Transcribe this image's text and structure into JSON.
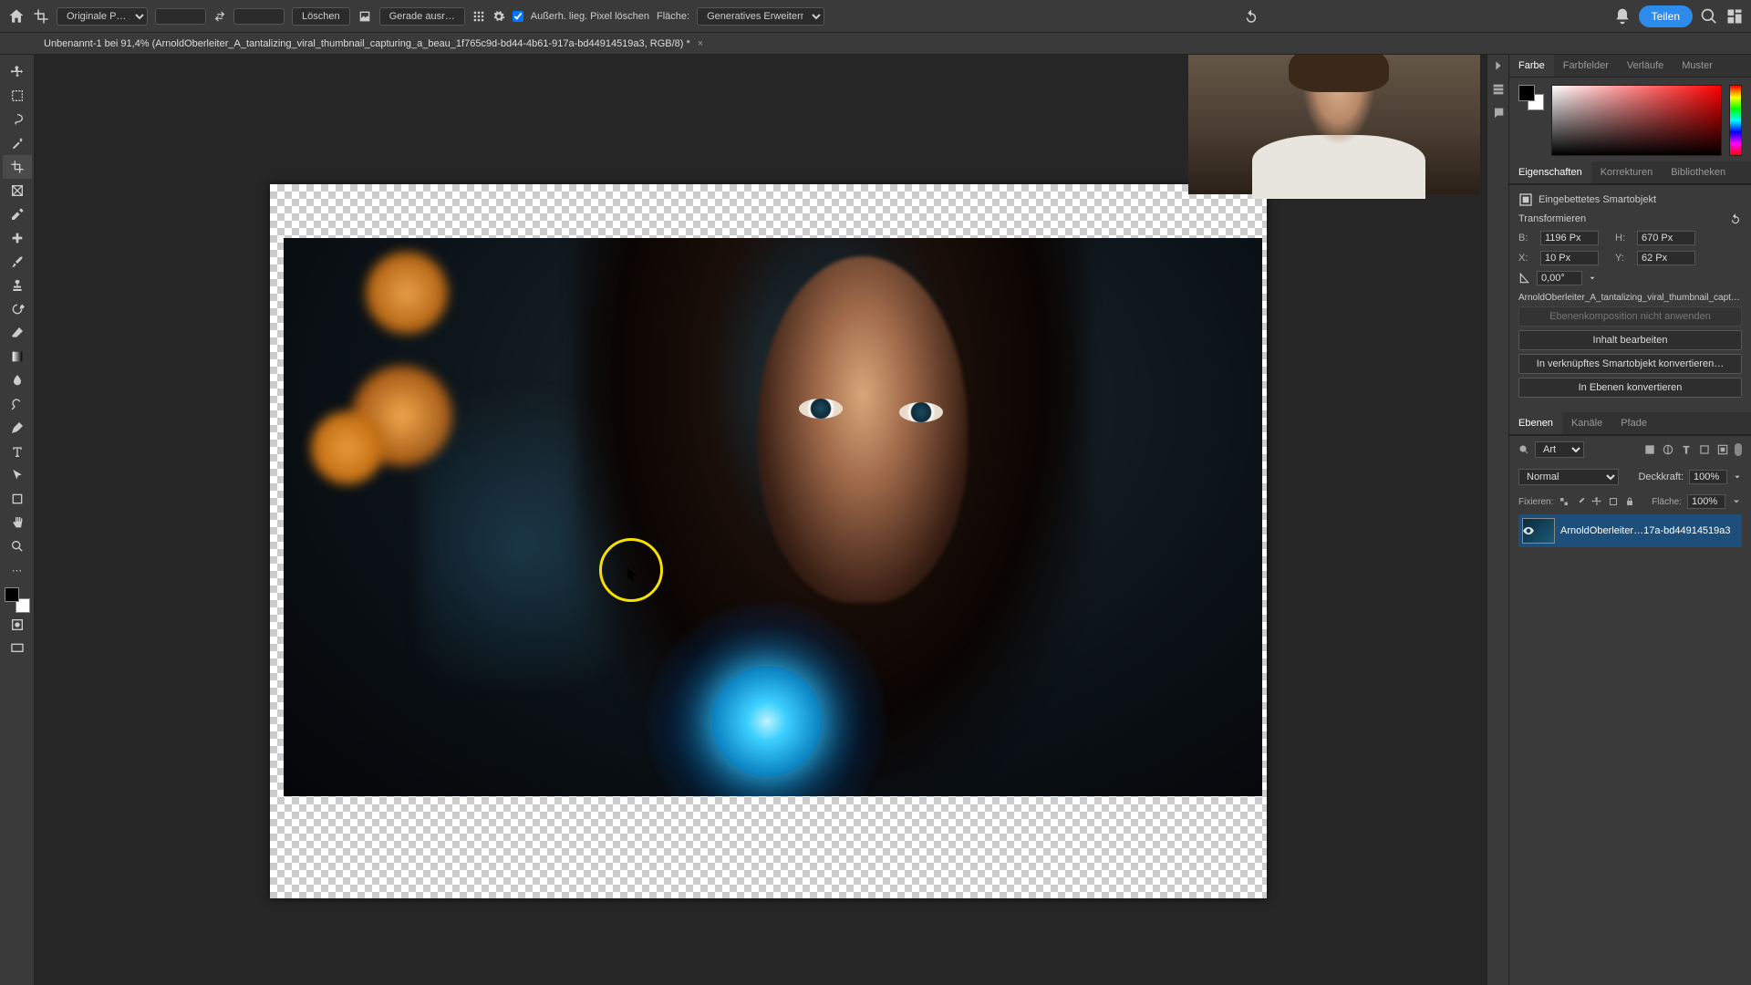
{
  "topbar": {
    "preset_label": "Originale P…",
    "delete_btn": "Löschen",
    "straighten_btn": "Gerade ausr…",
    "checkbox_label": "Außerh. lieg. Pixel löschen",
    "fill_label": "Fläche:",
    "fill_value": "Generatives Erweitern",
    "share_btn": "Teilen"
  },
  "doc": {
    "title": "Unbenannt-1 bei 91,4% (ArnoldOberleiter_A_tantalizing_viral_thumbnail_capturing_a_beau_1f765c9d-bd44-4b61-917a-bd44914519a3, RGB/8) *"
  },
  "panels": {
    "color_tabs": [
      "Farbe",
      "Farbfelder",
      "Verläufe",
      "Muster"
    ],
    "props_tabs": [
      "Eigenschaften",
      "Korrekturen",
      "Bibliotheken"
    ],
    "smartobj_label": "Eingebettetes Smartobjekt",
    "transform_label": "Transformieren",
    "w_label": "B:",
    "w_value": "1196 Px",
    "h_label": "H:",
    "h_value": "670 Px",
    "x_label": "X:",
    "x_value": "10 Px",
    "y_label": "Y:",
    "y_value": "62 Px",
    "angle_label": "⟲",
    "angle_value": "0,00°",
    "linked_name": "ArnoldOberleiter_A_tantalizing_viral_thumbnail_capt…",
    "comp_placeholder": "Ebenenkomposition nicht anwenden",
    "btn_edit": "Inhalt bearbeiten",
    "btn_convert_linked": "In verknüpftes Smartobjekt konvertieren…",
    "btn_convert_layers": "In Ebenen konvertieren",
    "layers_tabs": [
      "Ebenen",
      "Kanäle",
      "Pfade"
    ],
    "search_label": "Art",
    "blend_mode": "Normal",
    "opacity_label": "Deckkraft:",
    "opacity_value": "100%",
    "lock_label": "Fixieren:",
    "fill_label2": "Fläche:",
    "fill_value2": "100%",
    "layer_name": "ArnoldOberleiter…17a-bd44914519a3"
  }
}
